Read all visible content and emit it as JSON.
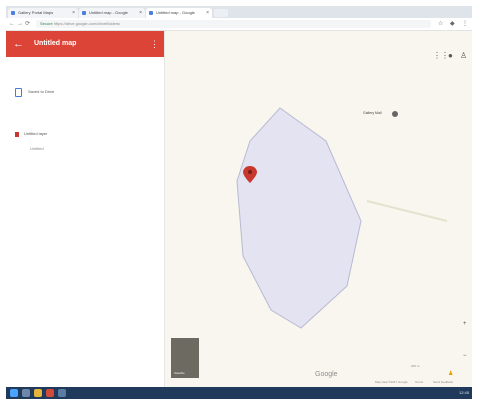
{
  "browser": {
    "tabs": [
      {
        "label": "Gallery Portal Maps"
      },
      {
        "label": "Untitled map - Google"
      },
      {
        "label": "Untitled map - Google"
      }
    ],
    "address": {
      "secure_label": "Secure",
      "url": "https://drive.google.com/drive/folders/"
    }
  },
  "panel": {
    "map_title": "Untitled map",
    "menu_icon": "more-vert-icon",
    "saved_label": "Saved to Drive",
    "layer_name": "Untitled layer",
    "layer_item": "Untitled"
  },
  "map": {
    "place_label": "Gallery Mall",
    "google_label": "Google",
    "thumb_label": "Satellite",
    "footer_left": "Map data ©2017 Google",
    "footer_mid": "Terms",
    "footer_right": "Send feedback",
    "scale_label": "200 m",
    "colors": {
      "polygon_fill": "#e3e3f2",
      "polygon_stroke": "#b9b9d2",
      "marker": "#c8372e",
      "header": "#dc4437"
    }
  },
  "taskbar": {
    "clock": "12:45"
  }
}
